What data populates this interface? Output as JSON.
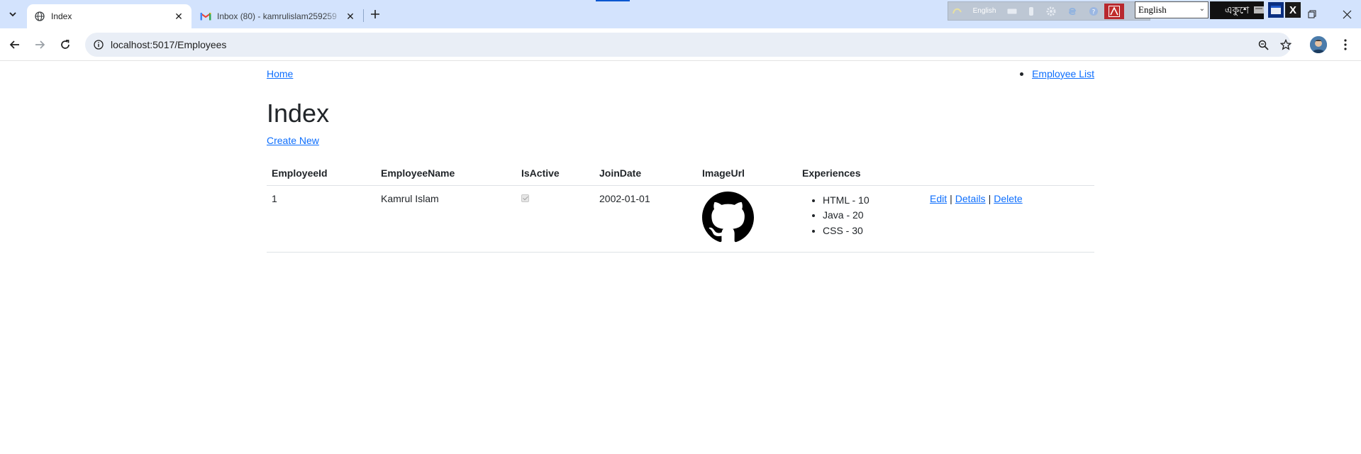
{
  "browser": {
    "tabs": [
      {
        "title": "Index",
        "active": true,
        "icon": "globe-icon"
      },
      {
        "title": "Inbox (80) - kamrulislam259259",
        "active": false,
        "icon": "gmail-icon"
      }
    ],
    "address": "localhost:5017/Employees",
    "ime": {
      "mini_lang": "English",
      "language": "English",
      "bangla_label": "একুশে"
    }
  },
  "nav": {
    "home": "Home",
    "employee_list": "Employee List"
  },
  "page": {
    "title": "Index",
    "create_new": "Create New"
  },
  "table": {
    "headers": [
      "EmployeeId",
      "EmployeeName",
      "IsActive",
      "JoinDate",
      "ImageUrl",
      "Experiences",
      ""
    ],
    "rows": [
      {
        "employee_id": "1",
        "employee_name": "Kamrul Islam",
        "is_active": true,
        "join_date": "2002-01-01",
        "image": "github-logo",
        "experiences": [
          "HTML - 10",
          "Java - 20",
          "CSS - 30"
        ],
        "actions": {
          "edit": "Edit",
          "details": "Details",
          "delete": "Delete",
          "separator": "|"
        }
      }
    ]
  },
  "colors": {
    "tabbar": "#d3e3fd",
    "link": "#0d6efd",
    "text": "#212529"
  }
}
